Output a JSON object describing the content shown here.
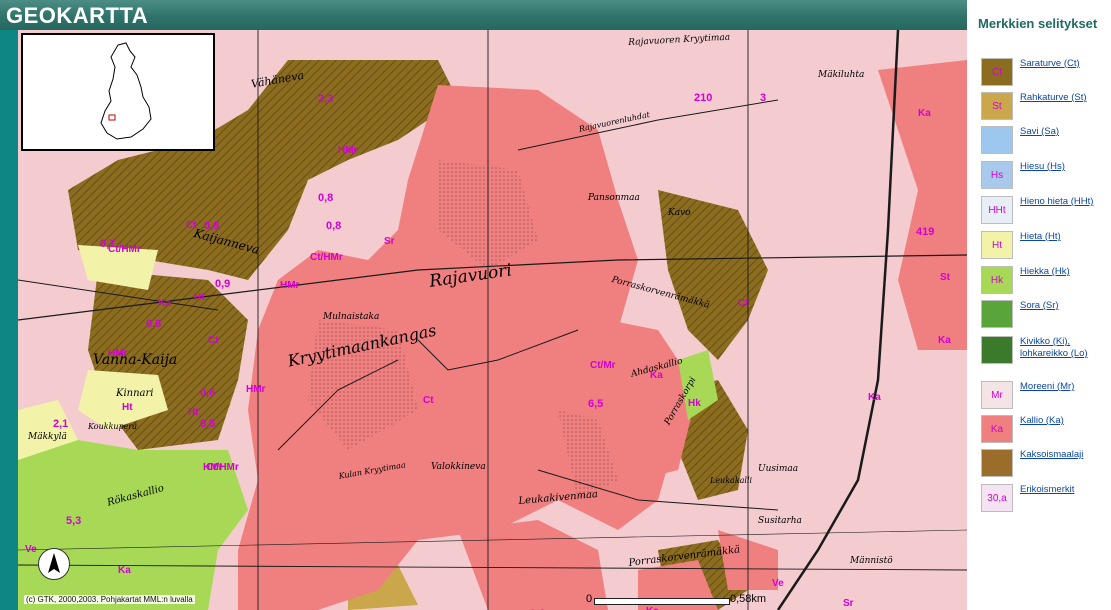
{
  "app": {
    "title": "GEOKARTTA"
  },
  "map": {
    "copyright": "(c) GTK, 2000,2003. Pohjakartat MML:n luvalla",
    "scale": {
      "start": "0",
      "end": "0,58km"
    },
    "labels": [
      "Vähäneva",
      "Kaijanneva",
      "Rajavuori",
      "Kryytimaankangas",
      "Mulnaistaka",
      "Vanha-Kaija",
      "Kinnari",
      "Mäkkylä",
      "Koukkuperä",
      "Rökaskallio",
      "Valokkineva",
      "Kulan Kryytimaa",
      "Leukakivenmaa",
      "Porraskorvenrämäkkä",
      "Porraskorpi",
      "Rajavuorenluhdat",
      "Rajavuoren Kryytimaa",
      "Mäkiluhta",
      "Pansonmaa",
      "Kavo",
      "Uusimaa",
      "Susitarha",
      "Männistö",
      "Porraskorvenrämäkkä",
      "Ahdaskallio",
      "Leukakalli"
    ],
    "codes": [
      "HMr",
      "HMr",
      "HMr",
      "HMr",
      "HMr",
      "Ct",
      "Ct",
      "Ct",
      "Ct",
      "Ka",
      "Ka",
      "Ka",
      "Ka",
      "Ka",
      "Ka",
      "Ka",
      "Ht",
      "Ht",
      "Ht",
      "Hk",
      "Sr",
      "Sr",
      "Sr",
      "Sr",
      "St",
      "Ve",
      "Ve",
      "Ct/HMr",
      "Ct/HMr",
      "Ct/Mr",
      "Ct/HMr"
    ],
    "spot_heights": [
      "210",
      "3",
      "0,7",
      "0,8",
      "0,8",
      "0,9",
      "0,6",
      "0,6",
      "0,6",
      "2,3",
      "5,3",
      "419",
      "6,5",
      "2,1",
      "0,5",
      "0,8"
    ]
  },
  "legend": {
    "title": "Merkkien selitykset",
    "items": [
      {
        "label": "Saraturve (Ct)",
        "symbol": "Ct",
        "color": "#8c6d1f"
      },
      {
        "label": "Rahkaturve (St)",
        "symbol": "St",
        "color": "#c9a74a"
      },
      {
        "label": "Savi (Sa)",
        "symbol": "",
        "color": "#9ec7f0"
      },
      {
        "label": "Hiesu (Hs)",
        "symbol": "Hs",
        "color": "#a8c9ec"
      },
      {
        "label": "Hieno hieta (HHt)",
        "symbol": "HHt",
        "color": "#e8eef6"
      },
      {
        "label": "Hieta (Ht)",
        "symbol": "Ht",
        "color": "#f2f3a8"
      },
      {
        "label": "Hiekka (Hk)",
        "symbol": "Hk",
        "color": "#a7d957"
      },
      {
        "label": "Sora (Sr)",
        "symbol": "",
        "color": "#5aa53a"
      },
      {
        "label": "Kivikko (Ki), lohkareikko (Lo)",
        "symbol": "",
        "color": "#3b7a2b"
      },
      {
        "label": "Moreeni (Mr)",
        "symbol": "Mr",
        "color": "#f4e4e6"
      },
      {
        "label": "Kallio (Ka)",
        "symbol": "Ka",
        "color": "#f07f7f"
      },
      {
        "label": "Kaksoismaalaji",
        "symbol": "",
        "color": "#9a6d2a"
      },
      {
        "label": "Erikoismerkit",
        "symbol": "30,a",
        "color": "#f4e4f2"
      }
    ]
  },
  "colors": {
    "header": "#2f736b",
    "sidebar": "#0e8684",
    "moraine": "#f4cccf",
    "bedrock": "#f07f7f",
    "peat": "#8c6d1f",
    "sand": "#a7d957",
    "fine_sand": "#f2f3a8",
    "legend_title": "#1f6a63",
    "legend_link": "#0a47a8",
    "symbol": "#d400d4"
  }
}
